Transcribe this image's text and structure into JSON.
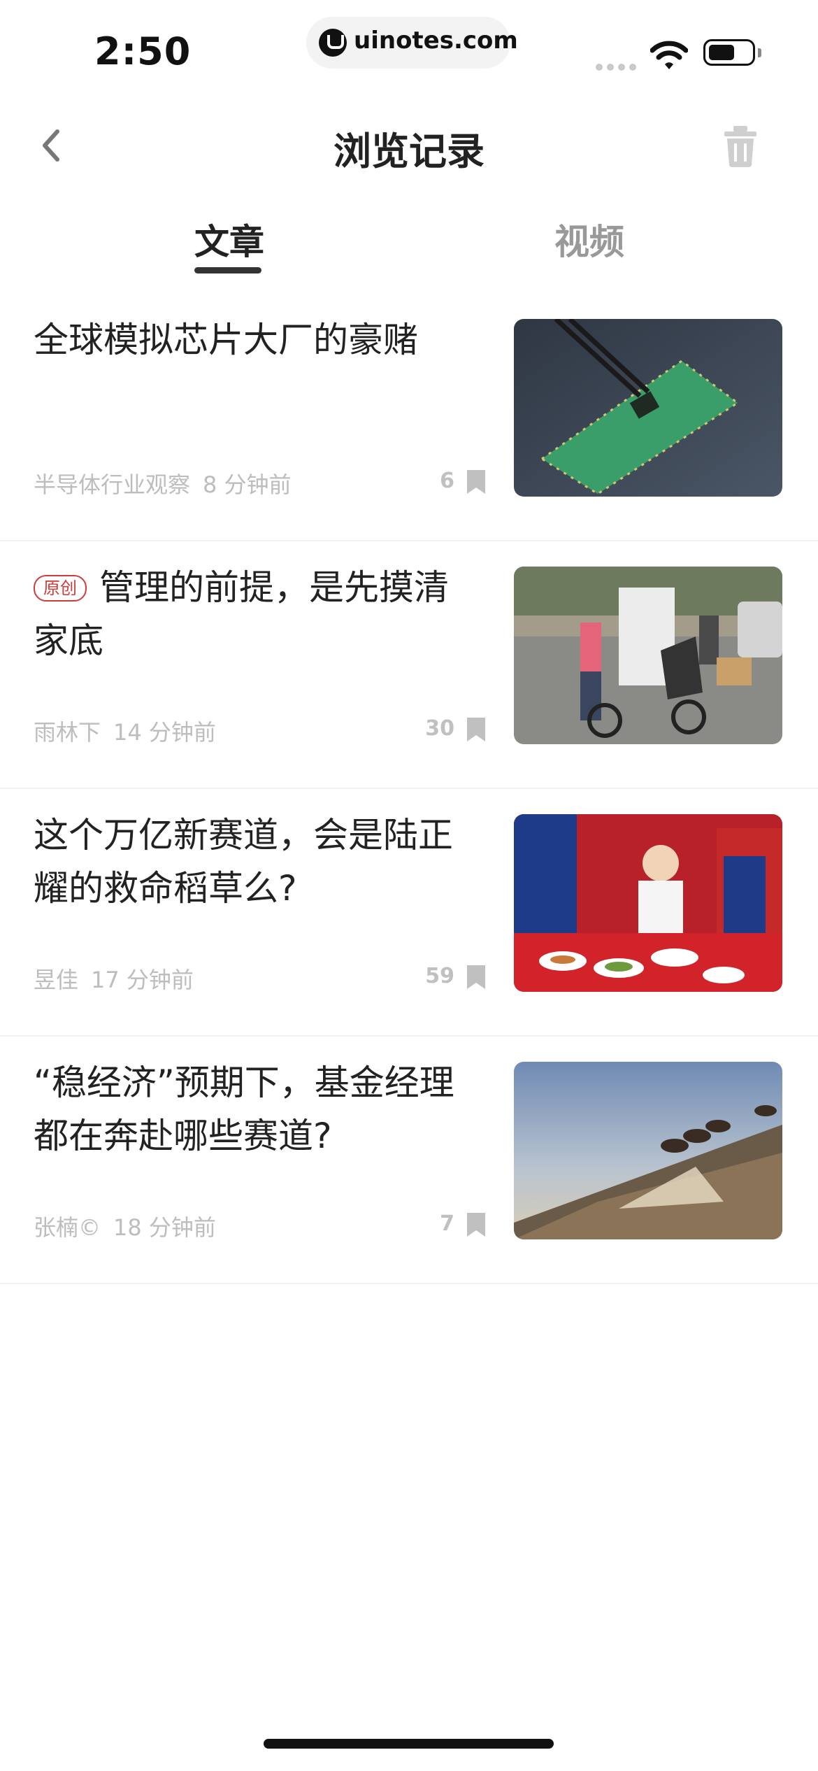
{
  "status_bar": {
    "time": "2:50",
    "url": "uinotes.com",
    "icons": [
      "cellular-signal-icon",
      "wifi-icon",
      "battery-icon"
    ]
  },
  "nav": {
    "title": "浏览记录",
    "back_icon": "chevron-left-icon",
    "trash_icon": "trash-icon"
  },
  "tabs": [
    {
      "label": "文章",
      "active": true
    },
    {
      "label": "视频",
      "active": false
    }
  ],
  "articles": [
    {
      "title": "全球模拟芯片大厂的豪赌",
      "badge": "",
      "source": "半导体行业观察",
      "time": "8 分钟前",
      "count": "6",
      "image": "chip-on-circuit-board"
    },
    {
      "title": "管理的前提，是先摸清家底",
      "badge": "原创",
      "source": "雨林下",
      "time": "14 分钟前",
      "count": "30",
      "image": "people-with-fridge-on-cart"
    },
    {
      "title": "这个万亿新赛道，会是陆正耀的救命稻草么?",
      "badge": "",
      "source": "昱佳",
      "time": "17 分钟前",
      "count": "59",
      "image": "chef-with-prepared-dishes"
    },
    {
      "title": "“稳经济”预期下，基金经理都在奔赴哪些赛道?",
      "badge": "",
      "source": "张楠©",
      "time": "18 分钟前",
      "count": "7",
      "image": "camels-on-sand-dune"
    }
  ],
  "colors": {
    "accent_badge": "#d23b3b",
    "meta_text": "#bdbdbd",
    "inactive_tab": "#999999"
  }
}
